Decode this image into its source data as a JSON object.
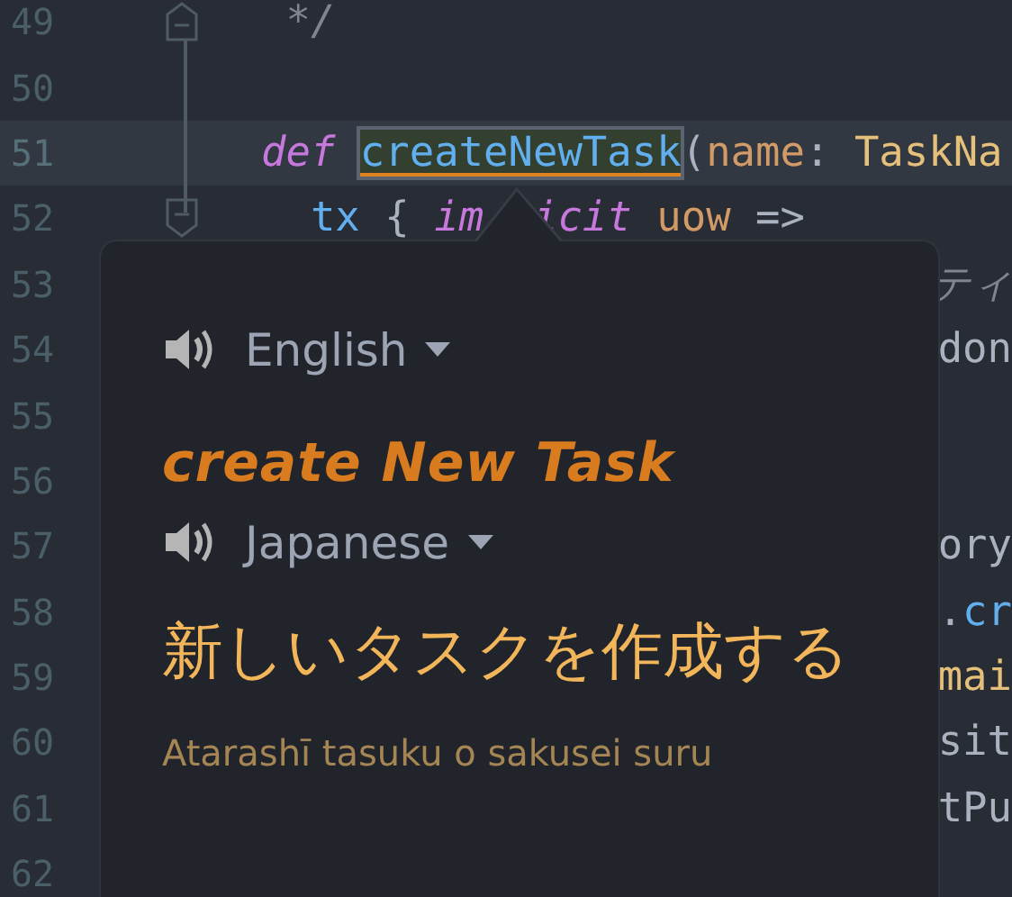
{
  "editor": {
    "lines": [
      {
        "number": "49",
        "kind": "fold_end",
        "current": false,
        "tokens": [
          {
            "text": " */",
            "kind": "comment",
            "highlighted": false,
            "covered_before": false
          }
        ]
      },
      {
        "number": "50",
        "kind": "plain",
        "current": false
      },
      {
        "number": "51",
        "kind": "plain",
        "current": true,
        "tokens": [
          {
            "text": "def",
            "kind": "keyword",
            "highlighted": false,
            "covered_before": false
          },
          {
            "text": "createNewTask",
            "kind": "function",
            "highlighted": true,
            "covered_before": false
          },
          {
            "text": "(",
            "kind": "punct",
            "highlighted": false,
            "covered_before": false
          },
          {
            "text": "name",
            "kind": "param",
            "highlighted": false,
            "covered_before": false
          },
          {
            "text": ": ",
            "kind": "punct",
            "highlighted": false,
            "covered_before": false
          },
          {
            "text": "TaskNa",
            "kind": "type",
            "highlighted": false,
            "covered_before": false
          }
        ]
      },
      {
        "number": "52",
        "kind": "fold_start",
        "current": false,
        "tokens": [
          {
            "text": "  tx",
            "kind": "function",
            "highlighted": false,
            "covered_before": false
          },
          {
            "text": " { ",
            "kind": "punct",
            "highlighted": false,
            "covered_before": false
          },
          {
            "text": "im",
            "kind": "keyword",
            "highlighted": false,
            "covered_before": false
          },
          {
            "text": "icit",
            "kind": "keyword",
            "highlighted": false,
            "covered_before": true
          },
          {
            "text": " uow",
            "kind": "param",
            "highlighted": false,
            "covered_before": false
          },
          {
            "text": " =>",
            "kind": "punct",
            "highlighted": false,
            "covered_before": false
          }
        ]
      },
      {
        "number": "53",
        "kind": "plain",
        "current": false,
        "visible_tail": [
          {
            "text": "ティ",
            "kind": "comment"
          }
        ]
      },
      {
        "number": "54",
        "kind": "plain",
        "current": false,
        "visible_tail": [
          {
            "text": "don",
            "kind": "plain"
          }
        ]
      },
      {
        "number": "55",
        "kind": "plain",
        "current": false
      },
      {
        "number": "56",
        "kind": "plain",
        "current": false
      },
      {
        "number": "57",
        "kind": "plain",
        "current": false,
        "visible_tail": [
          {
            "text": "ory",
            "kind": "plain"
          }
        ]
      },
      {
        "number": "58",
        "kind": "plain",
        "current": false,
        "visible_tail": [
          {
            "text": ".",
            "kind": "plain"
          },
          {
            "text": "cr",
            "kind": "function"
          }
        ]
      },
      {
        "number": "59",
        "kind": "plain",
        "current": false,
        "visible_tail": [
          {
            "text": "mai",
            "kind": "type"
          }
        ]
      },
      {
        "number": "60",
        "kind": "plain",
        "current": false,
        "visible_tail": [
          {
            "text": "sit",
            "kind": "plain"
          }
        ]
      },
      {
        "number": "61",
        "kind": "plain",
        "current": false,
        "visible_tail": [
          {
            "text": "tPu",
            "kind": "plain"
          }
        ]
      },
      {
        "number": "62",
        "kind": "plain",
        "current": false
      }
    ]
  },
  "translation_popup": {
    "source_language": "English",
    "source_text": "create New Task",
    "target_language": "Japanese",
    "translation": "新しいタスクを作成する",
    "romanization": "Atarashī tasuku o sakusei suru"
  }
}
